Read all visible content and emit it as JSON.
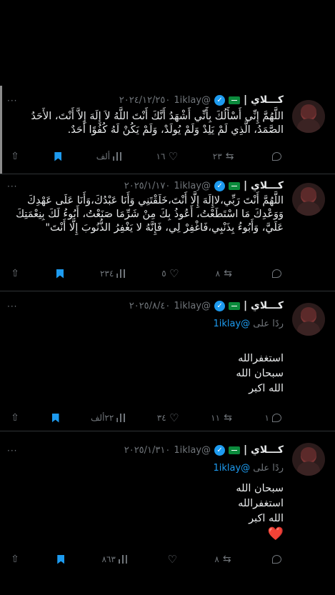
{
  "tweets": [
    {
      "name": "كـــلاي |",
      "handle": "@1iklay",
      "date": "٢٠٢٤/١٢/٢٥٠",
      "more": "···",
      "body": "اللَّهُمَّ إِنِّي أَسْأَلُكَ بِأَنِّي أَشْهَدُ أَنَّكَ أَنْتَ اللَّهُ لاَ إِلَهَ إِلاَّ أَنْتَ، الأَحَدُ الصَّمَدُ، الَّذِي لَمْ يَلِدْ وَلَمْ يُولَدْ، وَلَمْ يَكُنْ لَهُ كُفُوًا أَحَدٌ.",
      "reply_to": null,
      "actions": {
        "replies": "",
        "retweets": "٢٣",
        "likes": "١٦",
        "views": "ألف",
        "bookmark": ""
      }
    },
    {
      "name": "كـــلاي |",
      "handle": "@1iklay",
      "date": "٢٠٢٥/١/١٧٠",
      "more": "···",
      "body": "اللَّهُمَّ أَنْتَ رَبِّي،لاإِلَهَ إِلَّا أَنْتَ،خَلَقْتَنِي وَأَنَا عَبْدُكَ،وَأَنَا عَلَى عَهْدِكَ وَوَعْدِكَ مَا اسْتَطَعْتُ، أَعُوذُ بِكَ مِنْ شَرِّمَا صَنَعْتُ، أَبُوءُ لَكَ بِنِعْمَتِكَ عَلَيَّ، وَأَبُوءُ بِذَنْبِي،فَاغْفِرْ لِي، فَإِنَّهُ لا يَغْفِرُ الذُّنُوبَ إِلَّا أَنْتَ\"",
      "reply_to": null,
      "actions": {
        "replies": "",
        "retweets": "٨",
        "likes": "٥",
        "views": "٢٣٤",
        "bookmark": ""
      }
    },
    {
      "name": "كـــلاي |",
      "handle": "@1iklay",
      "date": "٢٠٢٥/٨/٤٠",
      "more": "···",
      "reply_prefix": "ردًا على",
      "reply_to": "@1iklay",
      "lines": [
        "استغفرالله",
        "سبحان الله",
        "الله اكبر"
      ],
      "actions": {
        "replies": "١",
        "retweets": "١١",
        "likes": "٣٤",
        "views": "٢٢ألف",
        "bookmark": ""
      }
    },
    {
      "name": "كـــلاي |",
      "handle": "@1iklay",
      "date": "٢٠٢٥/١/٣١٠",
      "more": "···",
      "reply_prefix": "ردًا على",
      "reply_to": "@1iklay",
      "lines": [
        "سبحان الله",
        "استغفرالله",
        "الله اكبر"
      ],
      "emoji": "❤️",
      "actions": {
        "replies": "",
        "retweets": "٨",
        "likes": "",
        "views": "٨٦٣",
        "bookmark": ""
      }
    }
  ],
  "colors": {
    "background": "#000000",
    "text": "#e7e9ea",
    "muted": "#71767b",
    "accent": "#1d9bf0",
    "divider": "#2f3336"
  }
}
